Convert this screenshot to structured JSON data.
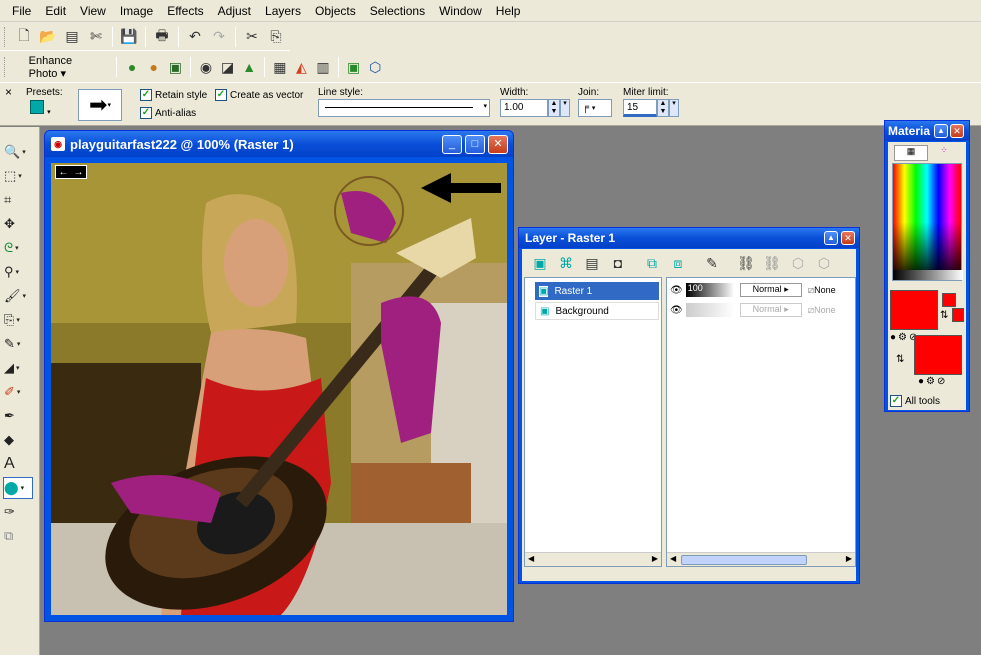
{
  "menu": [
    "File",
    "Edit",
    "View",
    "Image",
    "Effects",
    "Adjust",
    "Layers",
    "Objects",
    "Selections",
    "Window",
    "Help"
  ],
  "toolbar": {
    "enhance_label": "Enhance Photo"
  },
  "tool_options": {
    "close": "×",
    "presets_label": "Presets:",
    "retain_style_label": "Retain style",
    "anti_alias_label": "Anti-alias",
    "create_as_vector_label": "Create as vector",
    "line_style_label": "Line style:",
    "width_label": "Width:",
    "width_value": "1.00",
    "join_label": "Join:",
    "miter_label": "Miter limit:",
    "miter_value": "15"
  },
  "image_window": {
    "title": "playguitarfast222 @ 100% (Raster 1)"
  },
  "layers_window": {
    "title": "Layer - Raster 1",
    "layers": [
      {
        "name": "Raster 1",
        "opacity": "100",
        "blend": "Normal",
        "mask": "None",
        "selected": true
      },
      {
        "name": "Background",
        "opacity": "",
        "blend": "Normal",
        "mask": "None",
        "selected": false
      }
    ]
  },
  "materials_window": {
    "title": "Materia",
    "all_tools_label": "All tools",
    "foreground_color": "#ff0000",
    "background_color": "#ff0000"
  },
  "colors": {
    "title_blue": "#0054e3",
    "chrome": "#ece9d8",
    "workspace": "#7f7f7f"
  }
}
